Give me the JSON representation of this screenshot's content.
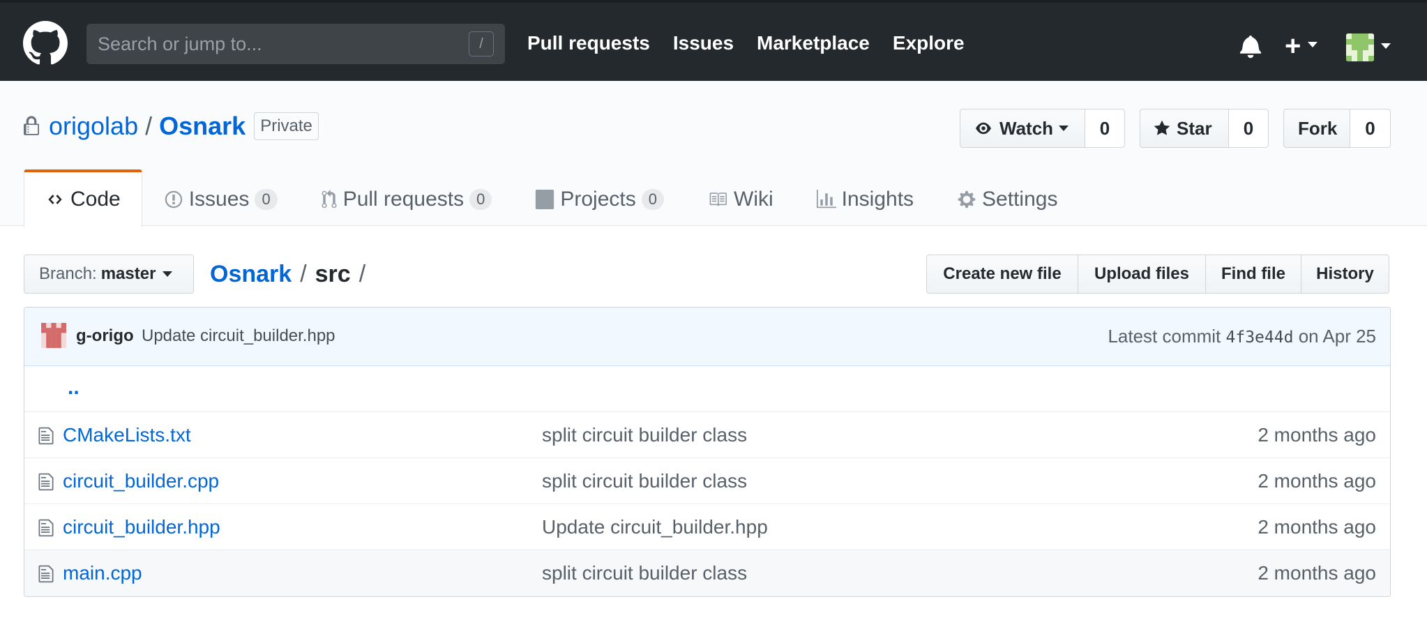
{
  "header": {
    "search_placeholder": "Search or jump to...",
    "search_shortcut": "/",
    "nav": [
      "Pull requests",
      "Issues",
      "Marketplace",
      "Explore"
    ],
    "plus_label": "+",
    "icons": [
      "github-logo-icon",
      "bell-icon",
      "plus-icon",
      "avatar"
    ]
  },
  "repo": {
    "owner": "origolab",
    "separator": "/",
    "name": "Osnark",
    "visibility_badge": "Private",
    "watch_label": "Watch",
    "watch_count": "0",
    "star_label": "Star",
    "star_count": "0",
    "fork_label": "Fork",
    "fork_count": "0"
  },
  "tabs": [
    {
      "label": "Code",
      "icon": "code-icon",
      "selected": true
    },
    {
      "label": "Issues",
      "count": "0",
      "icon": "issue-icon"
    },
    {
      "label": "Pull requests",
      "count": "0",
      "icon": "pull-request-icon"
    },
    {
      "label": "Projects",
      "count": "0",
      "icon": "project-icon"
    },
    {
      "label": "Wiki",
      "icon": "book-icon"
    },
    {
      "label": "Insights",
      "icon": "graph-icon"
    },
    {
      "label": "Settings",
      "icon": "gear-icon"
    }
  ],
  "file_nav": {
    "branch_prefix": "Branch:",
    "branch_name": "master",
    "breadcrumb_root": "Osnark",
    "breadcrumb_sep": "/",
    "breadcrumb_dir": "src",
    "breadcrumb_trailing": "/",
    "actions": [
      "Create new file",
      "Upload files",
      "Find file",
      "History"
    ]
  },
  "commit": {
    "author": "g-origo",
    "message": "Update circuit_builder.hpp",
    "latest_label": "Latest commit",
    "sha": "4f3e44d",
    "date": "on Apr 25"
  },
  "files": {
    "parent_link": "..",
    "rows": [
      {
        "name": "CMakeLists.txt",
        "message": "split circuit builder class",
        "age": "2 months ago"
      },
      {
        "name": "circuit_builder.cpp",
        "message": "split circuit builder class",
        "age": "2 months ago"
      },
      {
        "name": "circuit_builder.hpp",
        "message": "Update circuit_builder.hpp",
        "age": "2 months ago"
      },
      {
        "name": "main.cpp",
        "message": "split circuit builder class",
        "age": "2 months ago"
      }
    ]
  },
  "colors": {
    "header_bg": "#24292e",
    "link": "#0366d6",
    "selected_tab_accent": "#e36209",
    "commit_tease_bg": "#f1f8ff"
  }
}
